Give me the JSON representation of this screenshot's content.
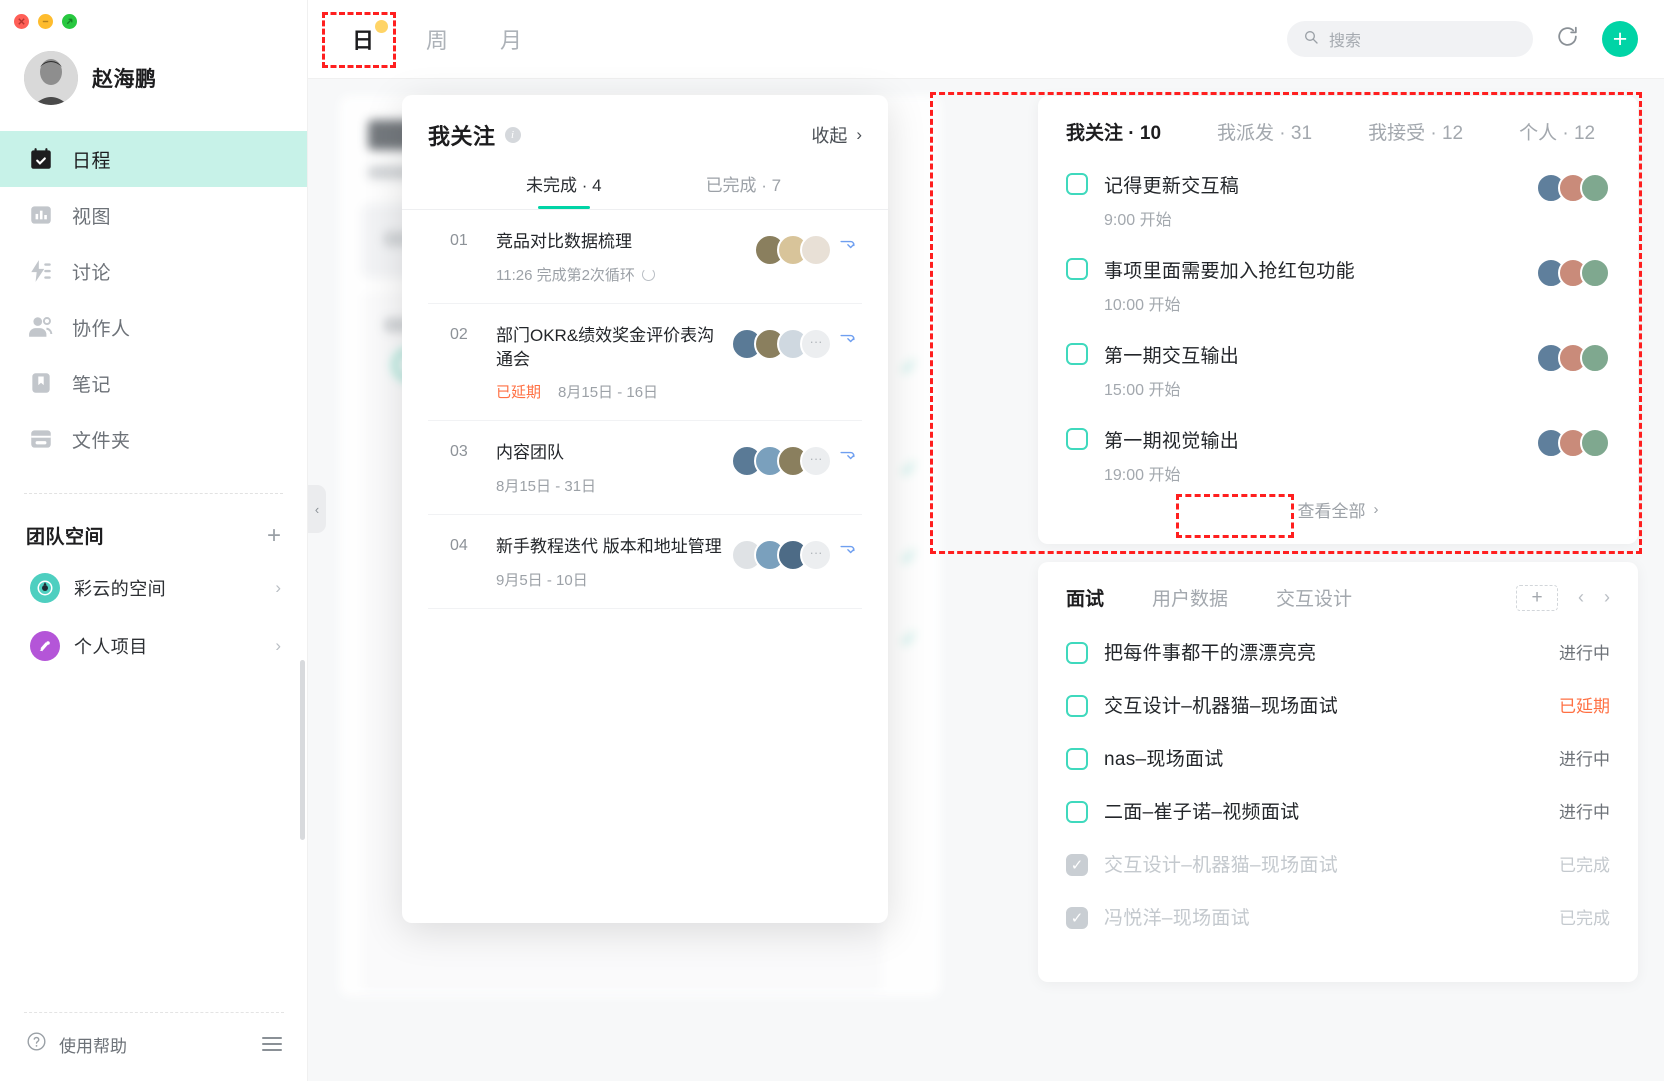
{
  "window": {
    "close": "close",
    "minimize": "minimize",
    "maximize": "maximize"
  },
  "sidebar": {
    "profile_name": "赵海鹏",
    "nav": [
      {
        "label": "日程",
        "icon": "calendar-icon",
        "active": true
      },
      {
        "label": "视图",
        "icon": "chart-icon",
        "active": false
      },
      {
        "label": "讨论",
        "icon": "discussion-icon",
        "active": false
      },
      {
        "label": "协作人",
        "icon": "people-icon",
        "active": false
      },
      {
        "label": "笔记",
        "icon": "bookmark-icon",
        "active": false
      },
      {
        "label": "文件夹",
        "icon": "folder-icon",
        "active": false
      }
    ],
    "team_title": "团队空间",
    "team_add": "+",
    "spaces": [
      {
        "label": "彩云的空间",
        "color": "#4ecfc0",
        "chevron": "›"
      },
      {
        "label": "个人项目",
        "color": "#b455d8",
        "chevron": "›"
      }
    ],
    "help_label": "使用帮助"
  },
  "topbar": {
    "view_tabs": [
      {
        "label": "日",
        "active": true
      },
      {
        "label": "周",
        "active": false
      },
      {
        "label": "月",
        "active": false
      }
    ],
    "search_placeholder": "搜索",
    "refresh_icon": "refresh-icon",
    "add_label": "+"
  },
  "modal": {
    "title": "我关注",
    "info_icon": "i",
    "collapse_label": "收起",
    "collapse_arrow": "›",
    "tabs": [
      {
        "label": "未完成 · 4",
        "active": true
      },
      {
        "label": "已完成 · 7",
        "active": false
      }
    ],
    "rows": [
      {
        "index": "01",
        "title": "竞品对比数据梳理",
        "status": "",
        "meta": "11:26 完成第2次循环",
        "cycle": true,
        "avatars": 3,
        "ghost": false
      },
      {
        "index": "02",
        "title": "部门OKR&绩效奖金评价表沟通会",
        "status": "已延期",
        "meta": "8月15日 - 16日",
        "cycle": false,
        "avatars": 3,
        "ghost": true
      },
      {
        "index": "03",
        "title": "内容团队",
        "status": "",
        "meta": "8月15日 - 31日",
        "cycle": false,
        "avatars": 3,
        "ghost": true
      },
      {
        "index": "04",
        "title": "新手教程迭代 版本和地址管理",
        "status": "",
        "meta": "9月5日 - 10日",
        "cycle": false,
        "avatars": 3,
        "ghost": true
      }
    ]
  },
  "focus_panel": {
    "tabs": [
      {
        "label": "我关注 · 10",
        "active": true
      },
      {
        "label": "我派发 · 31",
        "active": false
      },
      {
        "label": "我接受 · 12",
        "active": false
      },
      {
        "label": "个人 · 12",
        "active": false
      }
    ],
    "tasks": [
      {
        "title": "记得更新交互稿",
        "time": "9:00 开始",
        "done": false
      },
      {
        "title": "事项里面需要加入抢红包功能",
        "time": "10:00 开始",
        "done": false
      },
      {
        "title": "第一期交互输出",
        "time": "15:00 开始",
        "done": false
      },
      {
        "title": "第一期视觉输出",
        "time": "19:00 开始",
        "done": false
      }
    ],
    "view_all": "查看全部",
    "view_all_arrow": "›"
  },
  "interview_panel": {
    "tabs": [
      {
        "label": "面试",
        "active": true
      },
      {
        "label": "用户数据",
        "active": false
      },
      {
        "label": "交互设计",
        "active": false
      }
    ],
    "add_label": "+",
    "prev_arrow": "‹",
    "next_arrow": "›",
    "items": [
      {
        "title": "把每件事都干的漂漂亮亮",
        "status": "进行中",
        "state": "progress",
        "done": false
      },
      {
        "title": "交互设计–机器猫–现场面试",
        "status": "已延期",
        "state": "delayed",
        "done": false
      },
      {
        "title": "nas–现场面试",
        "status": "进行中",
        "state": "progress",
        "done": false
      },
      {
        "title": "二面–崔子诺–视频面试",
        "status": "进行中",
        "state": "progress",
        "done": false
      },
      {
        "title": "交互设计–机器猫–现场面试",
        "status": "已完成",
        "state": "finished",
        "done": true
      },
      {
        "title": "冯悦洋–现场面试",
        "status": "已完成",
        "state": "finished",
        "done": true
      }
    ]
  },
  "colors": {
    "accent": "#00d4a6",
    "active_nav_bg": "#c7f2e8",
    "delayed": "#ff7043",
    "annotation": "#ff1f1f"
  }
}
